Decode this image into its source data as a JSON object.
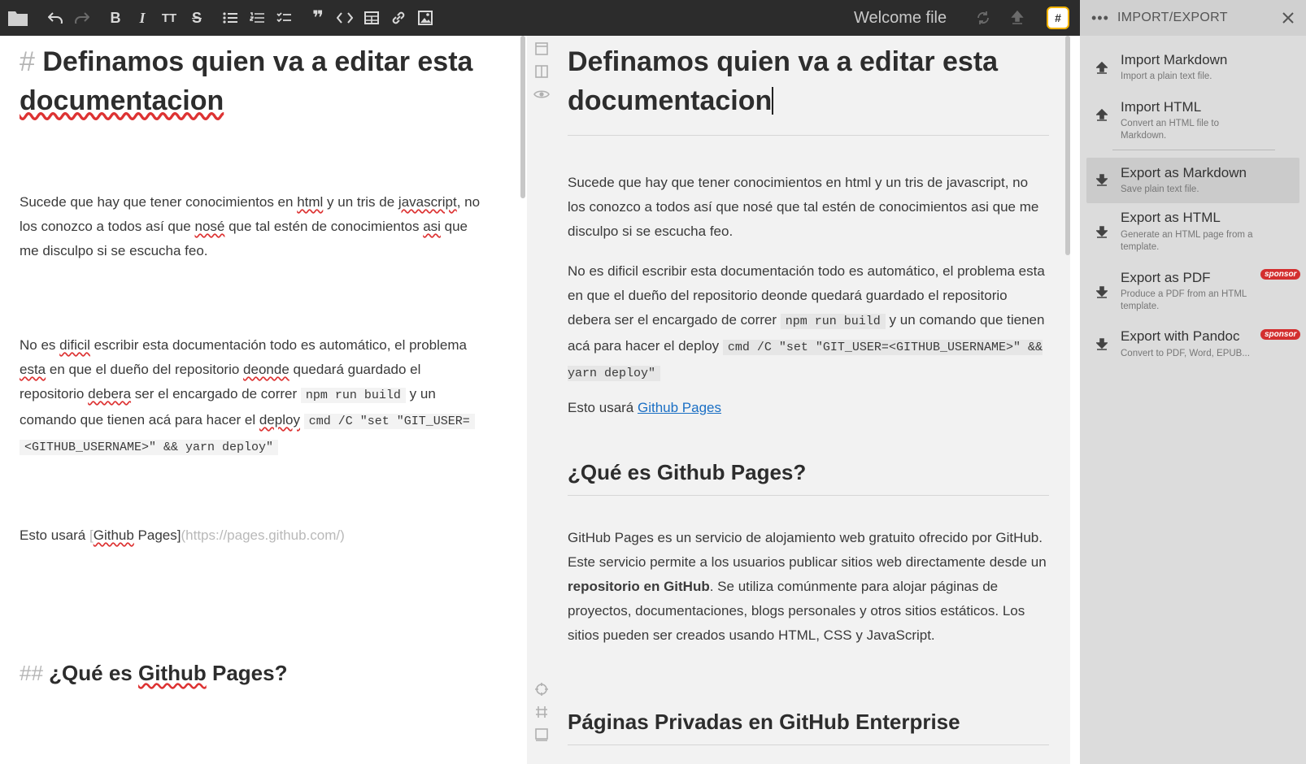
{
  "toolbar": {
    "file_title": "Welcome file",
    "workspace_badge": "#",
    "icons": [
      "folder-icon",
      "undo-icon",
      "redo-icon",
      "bold-icon",
      "italic-icon",
      "heading-icon",
      "strikethrough-icon",
      "bullet-list-icon",
      "numbered-list-icon",
      "checklist-icon",
      "quote-icon",
      "code-icon",
      "table-icon",
      "link-icon",
      "image-icon",
      "sync-icon",
      "publish-icon"
    ]
  },
  "editor": {
    "h1_mark": "#",
    "h1_line1": "Definamos quien va a editar esta",
    "h1_line2": "documentacion",
    "p1": {
      "a": "Sucede que hay que tener conocimientos en ",
      "b": "html",
      "c": " y un tris de ",
      "d": "javascript",
      "e": ", no",
      "line2_a": "los conozco a todos así que ",
      "line2_b": "nosé",
      "line2_c": " que tal estén de conocimientos ",
      "line2_d": "asi",
      "line2_e": " que",
      "line3": "me disculpo si se escucha feo."
    },
    "p2": {
      "l1_a": "No es ",
      "l1_b": "dificil",
      "l1_c": " escribir esta documentación todo es automático, el problema",
      "l2_a": "esta",
      "l2_b": " en que el dueño del repositorio ",
      "l2_c": "deonde",
      "l2_d": " quedará guardado el",
      "l3_a": "repositorio ",
      "l3_b": "debera",
      "l3_c": " ser el encargado de correr ",
      "l3_code": "npm run build",
      "l3_d": " y un",
      "l4_a": "comando que tienen acá para hacer el ",
      "l4_b": "deploy",
      "l4_code": "cmd /C \"set \"GIT_USER=",
      "l5_code": "<GITHUB_USERNAME>\" && yarn deploy\""
    },
    "p3": {
      "a": "Esto usará ",
      "bracket_open": "[",
      "link_a": "Github",
      "link_b": " Pages",
      "bracket_close": "]",
      "url": "(https://pages.github.com/)"
    },
    "h2_mark": "##",
    "h2_a": "¿Qué es ",
    "h2_b": "Github",
    "h2_c": " Pages?"
  },
  "preview": {
    "h1_line1": "Definamos quien va a editar esta",
    "h1_line2": "documentacion",
    "p1": "Sucede que hay que tener conocimientos en html y un tris de javascript, no los conozco a todos así que nosé que tal estén de conocimientos asi que me disculpo si se escucha feo.",
    "p2_a": "No es dificil escribir esta documentación todo es automático, el problema esta en que el dueño del repositorio deonde quedará guardado el repositorio debera ser el encargado de correr ",
    "p2_code1": "npm run build",
    "p2_b": " y un comando que tienen acá para hacer el deploy ",
    "p2_code2": "cmd /C \"set \"GIT_USER=<GITHUB_USERNAME>\" && yarn deploy\"",
    "p3_a": "Esto usará ",
    "p3_link": "Github Pages",
    "h2": "¿Qué es Github Pages?",
    "p4_a": "GitHub Pages es un servicio de alojamiento web gratuito ofrecido por GitHub. Este servicio permite a los usuarios publicar sitios web directamente desde un ",
    "p4_bold": "repositorio en GitHub",
    "p4_b": ". Se utiliza comúnmente para alojar páginas de proyectos, documentaciones, blogs personales y otros sitios estáticos. Los sitios pueden ser creados usando HTML, CSS y JavaScript.",
    "h2b": "Páginas Privadas en GitHub Enterprise"
  },
  "panel": {
    "title": "IMPORT/EXPORT",
    "items": [
      {
        "label": "Import Markdown",
        "desc": "Import a plain text file.",
        "icon": "upload-icon"
      },
      {
        "label": "Import HTML",
        "desc": "Convert an HTML file to Markdown.",
        "icon": "upload-icon"
      },
      {
        "label": "Export as Markdown",
        "desc": "Save plain text file.",
        "icon": "download-icon"
      },
      {
        "label": "Export as HTML",
        "desc": "Generate an HTML page from a template.",
        "icon": "download-icon"
      },
      {
        "label": "Export as PDF",
        "desc": "Produce a PDF from an HTML template.",
        "icon": "download-icon",
        "badge": "sponsor"
      },
      {
        "label": "Export with Pandoc",
        "desc": "Convert to PDF, Word, EPUB...",
        "icon": "download-icon",
        "badge": "sponsor"
      }
    ]
  },
  "colors": {
    "toolbar_bg": "#2c2c2c",
    "preview_bg": "#f2f2f2",
    "panel_bg": "#dcdcdc",
    "link": "#1a6fc4",
    "sponsor_badge": "#d32f2f",
    "workspace_border": "#f4b400"
  }
}
